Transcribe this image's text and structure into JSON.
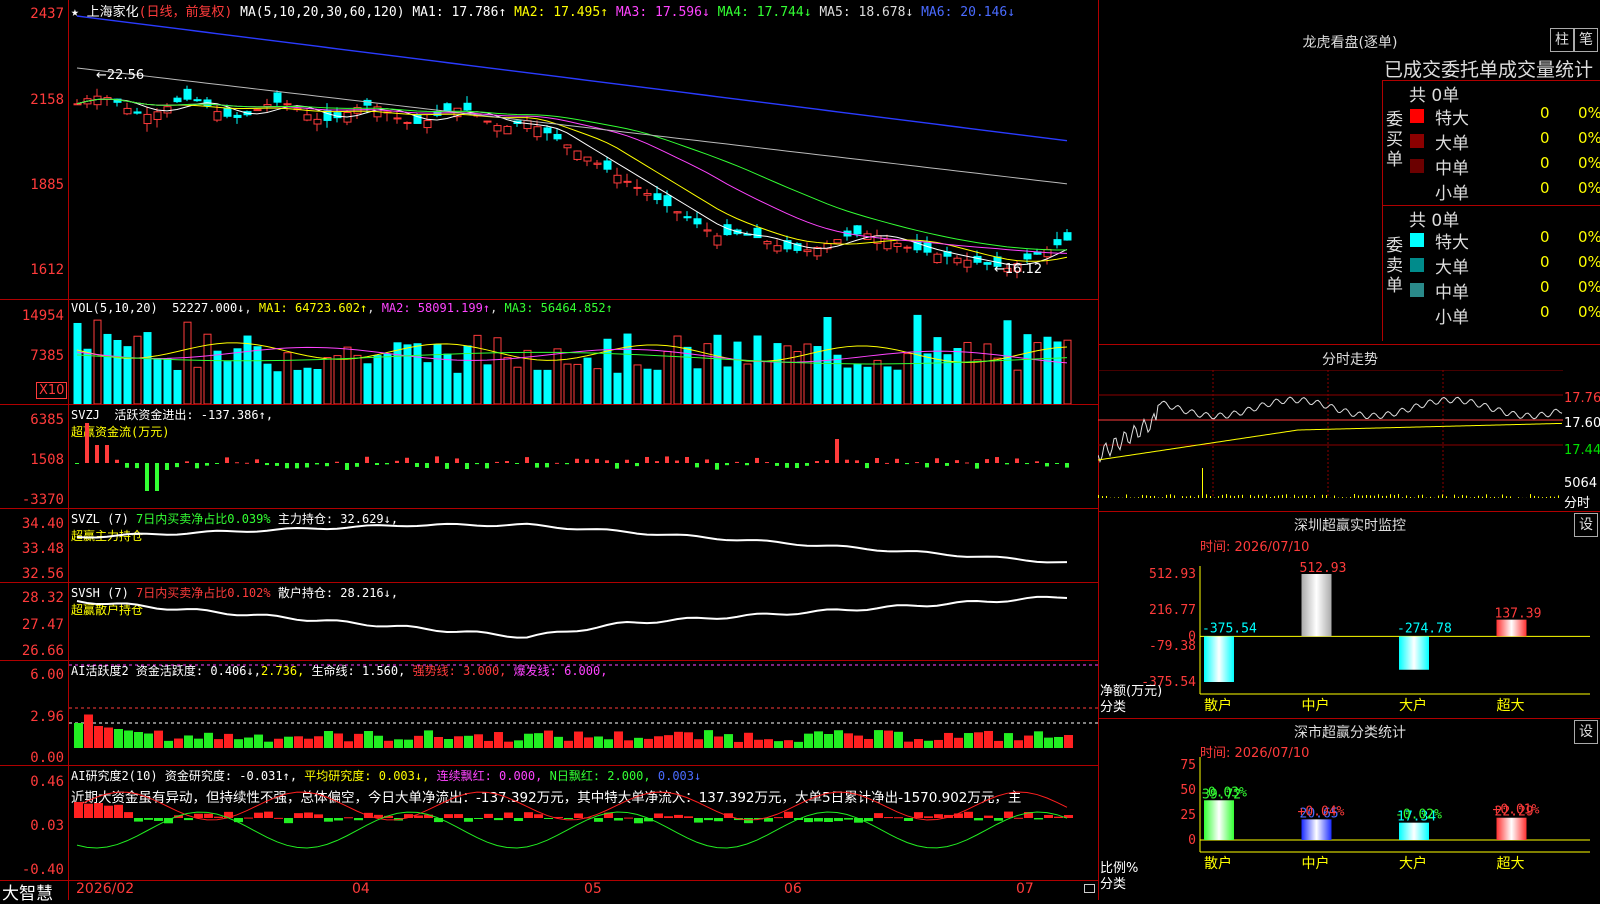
{
  "stock": {
    "name": "上海家化",
    "mode": "(日线，前复权)",
    "ma_label": "MA(5,10,20,30,60,120)",
    "ma_values": [
      {
        "label": "MA1:",
        "value": "17.786↑",
        "color": "#ffffff"
      },
      {
        "label": "MA2:",
        "value": "17.495↑",
        "color": "#ffff00"
      },
      {
        "label": "MA3:",
        "value": "17.596↓",
        "color": "#ff44ff"
      },
      {
        "label": "MA4:",
        "value": "17.744↓",
        "color": "#33ff33"
      },
      {
        "label": "MA5:",
        "value": "18.678↓",
        "color": "#dddddd"
      },
      {
        "label": "MA6:",
        "value": "20.146↓",
        "color": "#4a6bff"
      }
    ],
    "high_mark": "22.56",
    "low_mark": "16.12"
  },
  "price_axis": [
    "2437",
    "2158",
    "1885",
    "1612"
  ],
  "vol": {
    "title": "VOL(5,10,20)",
    "value": "52227.000↓",
    "ma1": "MA1: 64723.602↑",
    "ma2": "MA2: 58091.199↑",
    "ma3": "MA3: 56464.852↑",
    "axis": [
      "14954",
      "7385"
    ],
    "unit": "X10"
  },
  "svzj": {
    "title": "SVZJ",
    "desc": "活跃资金进出: -137.386↑,",
    "subtitle": "超赢资金流(万元)",
    "axis": [
      "6385",
      "1508",
      "-3370"
    ]
  },
  "svzl": {
    "title": "SVZL (7)",
    "ratio": "7日内买卖净占比0.039%",
    "hold": "主力持仓: 32.629↓,",
    "subtitle": "超赢主力持仓",
    "axis": [
      "34.40",
      "33.48",
      "32.56"
    ]
  },
  "svsh": {
    "title": "SVSH (7)",
    "ratio": "7日内买卖净占比0.102%",
    "hold": "散户持仓: 28.216↓,",
    "subtitle": "超赢散户持仓",
    "axis": [
      "28.32",
      "27.47",
      "26.66"
    ]
  },
  "ai_active": {
    "title": "AI活跃度2",
    "desc": "资金活跃度: 0.406↓,",
    "v2": "2.736,",
    "life": "生命线: 1.560,",
    "strong": "强势线: 3.000,",
    "burst": "爆发线: 6.000,",
    "axis": [
      "6.00",
      "2.96",
      "0.00"
    ]
  },
  "ai_research": {
    "title": "AI研究度2(10)",
    "desc": "资金研究度: -0.031↑,",
    "avg": "平均研究度: 0.003↓,",
    "cont": "连续飘红: 0.000,",
    "nday": "N日飘红: 2.000,",
    "last": "0.003↓",
    "comment": "近期大资金虽有异动，但持续性不强，总体偏空，今日大单净流出：-137.392万元，其中特大单净流入：137.392万元，大单5日累计净出-1570.902万元，主",
    "axis": [
      "0.46",
      "0.03",
      "-0.40"
    ]
  },
  "date_axis": [
    "2026/02",
    "04",
    "05",
    "06",
    "07"
  ],
  "brand": "大智慧",
  "dragon": {
    "title": "龙虎看盘(逐单)",
    "btn1": "柱",
    "btn2": "笔",
    "header": "已成交委托单成交量统计",
    "buy_label": "委买单",
    "sell_label": "委卖单",
    "buy_total": "共 0单",
    "sell_total": "共 0单",
    "buy_rows": [
      {
        "name": "特大",
        "count": "0",
        "pct": "0%",
        "color": "#ff0000"
      },
      {
        "name": "大单",
        "count": "0",
        "pct": "0%",
        "color": "#8b0000"
      },
      {
        "name": "中单",
        "count": "0",
        "pct": "0%",
        "color": "#6b0000"
      },
      {
        "name": "小单",
        "count": "0",
        "pct": "0%",
        "color": ""
      }
    ],
    "sell_rows": [
      {
        "name": "特大",
        "count": "0",
        "pct": "0%",
        "color": "#00ffff"
      },
      {
        "name": "大单",
        "count": "0",
        "pct": "0%",
        "color": "#008b8b"
      },
      {
        "name": "中单",
        "count": "0",
        "pct": "0%",
        "color": "#2a8a8a"
      },
      {
        "name": "小单",
        "count": "0",
        "pct": "0%",
        "color": ""
      }
    ]
  },
  "intraday": {
    "title": "分时走势",
    "axis": [
      "17.76",
      "17.60",
      "17.44"
    ],
    "vol_axis": "5064",
    "vol_unit": "分时"
  },
  "sz_monitor": {
    "title": "深圳超赢实时监控",
    "btn": "设",
    "time": "时间: 2026/07/10",
    "axis": [
      "512.93",
      "216.77",
      "0",
      "-79.38",
      "-375.54"
    ],
    "ylabel": "净额(万元)",
    "xlabel": "分类",
    "bars": [
      {
        "cat": "散户",
        "value": -375.54,
        "label": "-375.54"
      },
      {
        "cat": "中户",
        "value": 512.93,
        "label": "512.93"
      },
      {
        "cat": "大户",
        "value": -274.78,
        "label": "-274.78"
      },
      {
        "cat": "超大",
        "value": 137.39,
        "label": "137.39"
      }
    ]
  },
  "sz_stats": {
    "title": "深市超赢分类统计",
    "btn": "设",
    "time": "时间: 2026/07/10",
    "axis": [
      "75",
      "50",
      "25",
      "0"
    ],
    "ylabel": "比例%",
    "xlabel": "分类",
    "bars": [
      {
        "cat": "散户",
        "value": 39.72,
        "label": "39.72",
        "delta": "-0.03%"
      },
      {
        "cat": "中户",
        "value": 20.65,
        "label": "20.65",
        "delta": "+0.04%"
      },
      {
        "cat": "大户",
        "value": 17.34,
        "label": "17.34",
        "delta": "-0.02%"
      },
      {
        "cat": "超大",
        "value": 22.29,
        "label": "22.29",
        "delta": "+0.01%"
      }
    ]
  },
  "chart_data": [
    {
      "type": "bar",
      "title": "深圳超赢实时监控",
      "xlabel": "分类",
      "ylabel": "净额(万元)",
      "categories": [
        "散户",
        "中户",
        "大户",
        "超大"
      ],
      "values": [
        -375.54,
        512.93,
        -274.78,
        137.39
      ],
      "ylim": [
        -375.54,
        512.93
      ]
    },
    {
      "type": "bar",
      "title": "深市超赢分类统计",
      "xlabel": "分类",
      "ylabel": "比例%",
      "categories": [
        "散户",
        "中户",
        "大户",
        "超大"
      ],
      "values": [
        39.72,
        20.65,
        17.34,
        22.29
      ],
      "ylim": [
        0,
        75
      ]
    }
  ]
}
